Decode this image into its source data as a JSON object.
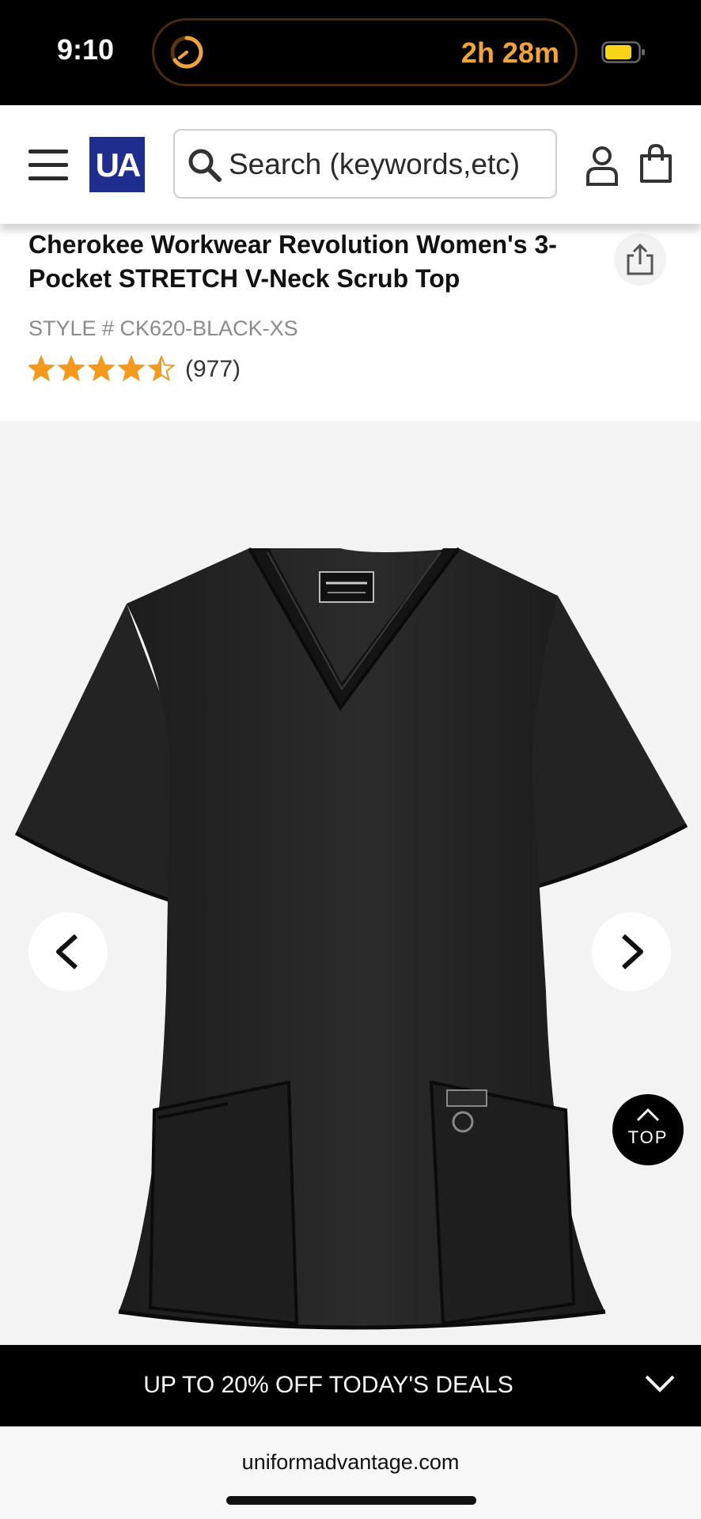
{
  "status_bar": {
    "time": "9:10",
    "activity_timer": "2h 28m",
    "timer_icon": "timer-ring-icon",
    "battery_icon": "battery-icon",
    "accent_color": "#f0a33a"
  },
  "header": {
    "menu_icon": "hamburger-menu-icon",
    "logo_text": "UA",
    "logo_color": "#1f2d8f",
    "search": {
      "placeholder": "Search (keywords,etc)",
      "value": ""
    },
    "account_icon": "user-account-icon",
    "bag_icon": "shopping-bag-icon"
  },
  "product": {
    "title": "Cherokee Workwear Revolution Women's 3-Pocket STRETCH V-Neck Scrub Top",
    "style_number": "STYLE # CK620-BLACK-XS",
    "rating": 4.5,
    "rating_max": 5,
    "review_count": "(977)",
    "share_icon": "share-icon",
    "star_color": "#f39a1e"
  },
  "gallery": {
    "image_alt": "Black V-neck scrub top",
    "prev_icon": "chevron-left-icon",
    "next_icon": "chevron-right-icon"
  },
  "back_to_top": {
    "label": "TOP"
  },
  "promo": {
    "text": "UP TO 20% OFF TODAY'S DEALS",
    "icon": "chevron-down-icon"
  },
  "browser": {
    "url": "uniformadvantage.com"
  }
}
